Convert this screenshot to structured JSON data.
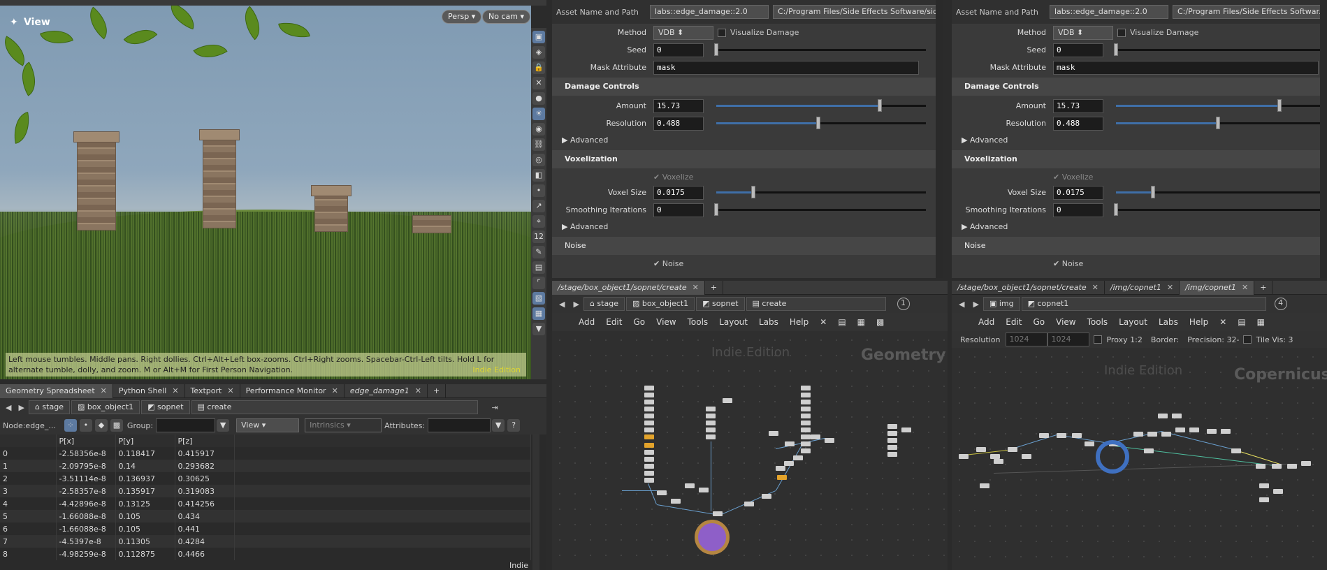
{
  "viewport": {
    "title": "View",
    "persp": "Persp",
    "cam": "No cam",
    "hint": "Left mouse tumbles. Middle pans. Right dollies. Ctrl+Alt+Left box-zooms. Ctrl+Right zooms. Spacebar-Ctrl-Left tilts. Hold L for alternate tumble, dolly, and zoom. M or Alt+M for First Person Navigation.",
    "edition": "Indie Edition"
  },
  "bottom_left": {
    "tabs": [
      "Geometry Spreadsheet",
      "Python Shell",
      "Textport",
      "Performance Monitor",
      "edge_damage1"
    ],
    "path": [
      "stage",
      "box_object1",
      "sopnet",
      "create"
    ],
    "node_label": "Node:",
    "node_value": "edge_...",
    "group_label": "Group:",
    "view_label": "View",
    "intrinsics_label": "Intrinsics",
    "attributes_label": "Attributes:",
    "columns": [
      "",
      "P[x]",
      "P[y]",
      "P[z]"
    ],
    "rows": [
      [
        "0",
        "-2.58356e-8",
        "0.118417",
        "0.415917"
      ],
      [
        "1",
        "-2.09795e-8",
        "0.14",
        "0.293682"
      ],
      [
        "2",
        "-3.51114e-8",
        "0.136937",
        "0.30625"
      ],
      [
        "3",
        "-2.58357e-8",
        "0.135917",
        "0.319083"
      ],
      [
        "4",
        "-4.42896e-8",
        "0.13125",
        "0.414256"
      ],
      [
        "5",
        "-1.66088e-8",
        "0.105",
        "0.434"
      ],
      [
        "6",
        "-1.66088e-8",
        "0.105",
        "0.441"
      ],
      [
        "7",
        "-4.5397e-8",
        "0.11305",
        "0.4284"
      ],
      [
        "8",
        "-4.98259e-8",
        "0.112875",
        "0.4466"
      ]
    ],
    "footer": "Indie"
  },
  "params": [
    {
      "asset_label": "Asset Name and Path",
      "asset": "labs::edge_damage::2.0",
      "path": "C:/Program Files/Side Effects Software/sid...",
      "method_label": "Method",
      "method": "VDB",
      "visualize": "Visualize Damage",
      "seed_label": "Seed",
      "seed": "0",
      "mask_label": "Mask Attribute",
      "mask": "mask",
      "sect1": "Damage Controls",
      "amount_label": "Amount",
      "amount": "15.73",
      "res_label": "Resolution",
      "res": "0.488",
      "adv": "Advanced",
      "sect2": "Voxelization",
      "voxelize": "Voxelize",
      "voxel_label": "Voxel Size",
      "voxel": "0.0175",
      "smooth_label": "Smoothing Iterations",
      "smooth": "0",
      "adv2": "Advanced",
      "sect3": "Noise",
      "noise": "Noise"
    },
    {
      "asset_label": "Asset Name and Path",
      "asset": "labs::edge_damage::2.0",
      "path": "C:/Program Files/Side Effects Softwar...",
      "method_label": "Method",
      "method": "VDB",
      "visualize": "Visualize Damage",
      "seed_label": "Seed",
      "seed": "0",
      "mask_label": "Mask Attribute",
      "mask": "mask",
      "sect1": "Damage Controls",
      "amount_label": "Amount",
      "amount": "15.73",
      "res_label": "Resolution",
      "res": "0.488",
      "adv": "Advanced",
      "sect2": "Voxelization",
      "voxelize": "Voxelize",
      "voxel_label": "Voxel Size",
      "voxel": "0.0175",
      "smooth_label": "Smoothing Iterations",
      "smooth": "0",
      "adv2": "Advanced",
      "sect3": "Noise",
      "noise": "Noise"
    }
  ],
  "net_left": {
    "tab": "/stage/box_object1/sopnet/create",
    "path": [
      "stage",
      "box_object1",
      "sopnet",
      "create"
    ],
    "count": "1",
    "menu": [
      "Add",
      "Edit",
      "Go",
      "View",
      "Tools",
      "Layout",
      "Labs",
      "Help"
    ],
    "edition": "Indie Edition",
    "context": "Geometry"
  },
  "net_right": {
    "tabs": [
      "/stage/box_object1/sopnet/create",
      "/img/copnet1",
      "/img/copnet1"
    ],
    "path": [
      "img",
      "copnet1"
    ],
    "count": "4",
    "menu": [
      "Add",
      "Edit",
      "Go",
      "View",
      "Tools",
      "Layout",
      "Labs",
      "Help"
    ],
    "res_label": "Resolution",
    "res_w": "1024",
    "res_h": "1024",
    "proxy": "Proxy 1:2",
    "border": "Border:",
    "precision": "Precision: 32-",
    "tilevis": "Tile Vis: 3",
    "edition": "Indie Edition",
    "context": "Copernicus"
  }
}
